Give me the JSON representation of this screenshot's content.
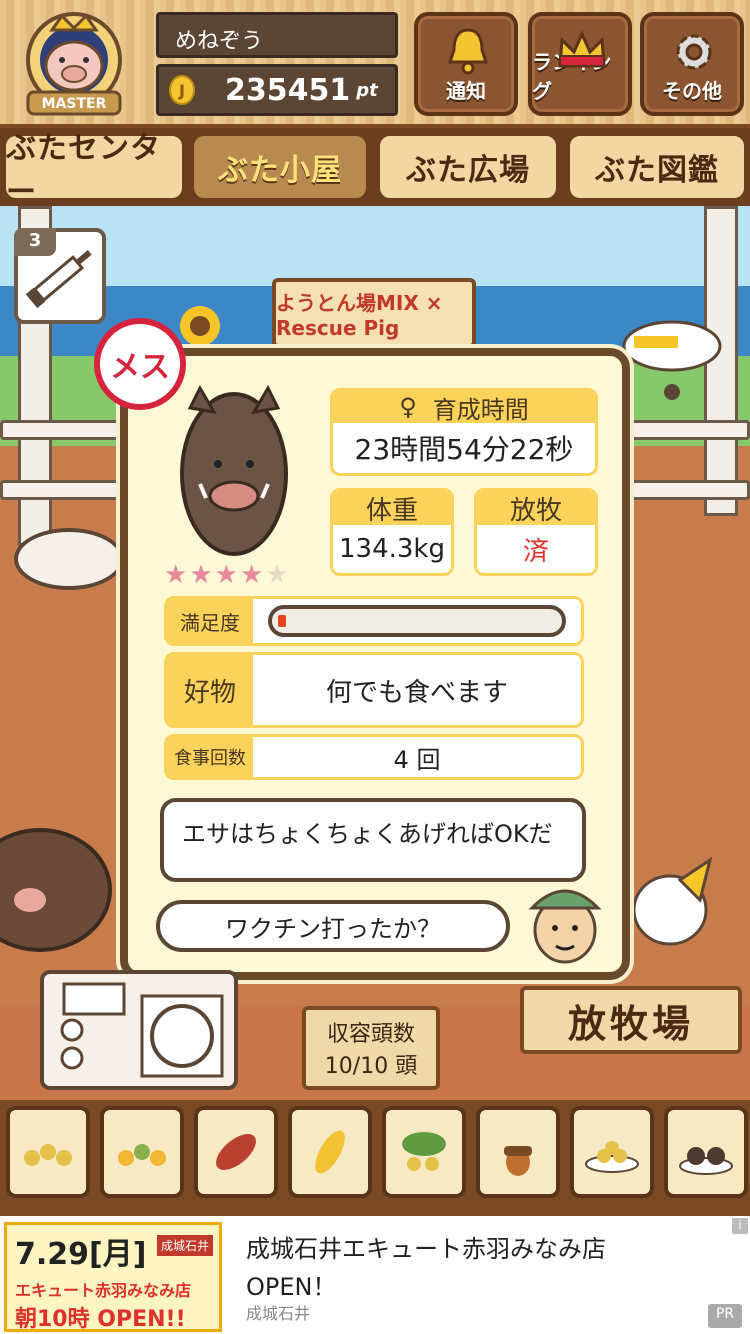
{
  "header": {
    "badge_label": "MASTER",
    "user_name": "めねぞう",
    "coin_symbol": "J",
    "points": "235451",
    "points_unit": "pt",
    "buttons": [
      {
        "label": "通知",
        "icon": "bell-icon"
      },
      {
        "label": "ランキング",
        "icon": "crown-icon"
      },
      {
        "label": "その他",
        "icon": "gear-icon"
      }
    ]
  },
  "tabs": [
    {
      "label": "ぶたセンター",
      "active": false
    },
    {
      "label": "ぶた小屋",
      "active": true
    },
    {
      "label": "ぶた広場",
      "active": false
    },
    {
      "label": "ぶた図鑑",
      "active": false
    }
  ],
  "scene": {
    "syringe_count": "3",
    "sign_text": "ようとん場MIX × Rescue Pig"
  },
  "pig_card": {
    "gender_label": "メス",
    "stars_filled": 4,
    "stars_total": 5,
    "growth_time_label": "育成時間",
    "growth_time_value": "23時間54分22秒",
    "weight_label": "体重",
    "weight_value": "134.3kg",
    "grazing_label": "放牧",
    "grazing_value": "済",
    "satisfaction_label": "満足度",
    "satisfaction_level": 0.03,
    "favorite_label": "好物",
    "favorite_value": "何でも食べます",
    "meals_label": "食事回数",
    "meals_value": "4 回",
    "speech_main": "エサはちょくちょくあげればOKだ",
    "speech_reply": "ワクチン打ったか？"
  },
  "bottom": {
    "capacity_label": "収容頭数",
    "capacity_value": "10/10 頭",
    "pasture_label": "放牧場",
    "feeds": [
      "beans-icon",
      "corn-mix-icon",
      "sweet-potato-icon",
      "corn-icon",
      "vegetable-icon",
      "acorn-icon",
      "grain-plate-icon",
      "dark-balls-icon"
    ]
  },
  "ad": {
    "image_lines": [
      "7.29[月]",
      "エキュート赤羽みなみ店",
      "朝10時 OPEN!!"
    ],
    "image_brand": "成城石井",
    "title": "成城石井エキュート赤羽みなみ店OPEN！",
    "sponsor": "成城石井",
    "pr_label": "PR",
    "info_label": "i"
  },
  "colors": {
    "accent_yellow": "#fbd35a",
    "wood": "#7a4a24",
    "female_red": "#d7243d",
    "ground": "#c97c4b"
  }
}
